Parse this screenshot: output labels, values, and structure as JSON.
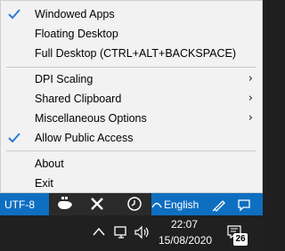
{
  "menu": {
    "items": [
      {
        "label": "Windowed Apps",
        "checked": true,
        "submenu": false
      },
      {
        "label": "Floating Desktop",
        "checked": false,
        "submenu": false
      },
      {
        "label": "Full Desktop (CTRL+ALT+BACKSPACE)",
        "checked": false,
        "submenu": false
      },
      {
        "label": "DPI Scaling",
        "checked": false,
        "submenu": true
      },
      {
        "label": "Shared Clipboard",
        "checked": false,
        "submenu": true
      },
      {
        "label": "Miscellaneous Options",
        "checked": false,
        "submenu": true
      },
      {
        "label": "Allow Public Access",
        "checked": true,
        "submenu": false
      },
      {
        "label": "About",
        "checked": false,
        "submenu": false
      },
      {
        "label": "Exit",
        "checked": false,
        "submenu": false
      }
    ],
    "submenu_arrow": "›",
    "check_color": "#2b7bd8"
  },
  "statusbar": {
    "encoding": "UTF-8",
    "language": "English",
    "color": "#0e6fc1"
  },
  "taskbar": {
    "time": "22:07",
    "date": "15/08/2020",
    "notification_count": "26"
  }
}
